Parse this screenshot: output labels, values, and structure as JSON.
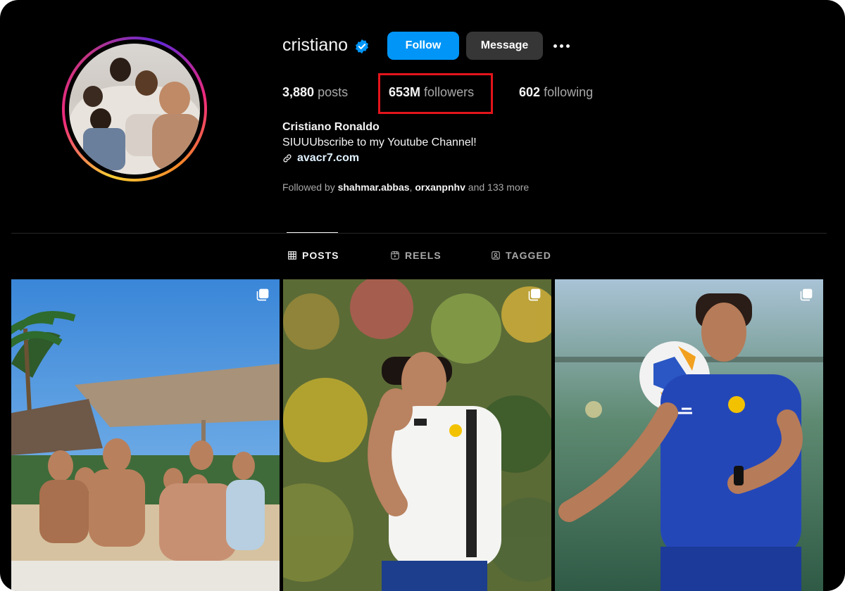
{
  "profile": {
    "username": "cristiano",
    "follow_label": "Follow",
    "message_label": "Message",
    "posts_count": "3,880",
    "posts_label": "posts",
    "followers_count": "653M",
    "followers_label": "followers",
    "following_count": "602",
    "following_label": "following",
    "full_name": "Cristiano Ronaldo",
    "bio": "SIUUUbscribe to my Youtube Channel!",
    "link": "avacr7.com",
    "followed_by_prefix": "Followed by",
    "followed_by_user1": "shahmar.abbas",
    "followed_by_sep": ",",
    "followed_by_user2": "orxanpnhv",
    "followed_by_suffix": "and 133 more"
  },
  "tabs": [
    {
      "label": "POSTS",
      "icon": "grid-icon",
      "active": true
    },
    {
      "label": "REELS",
      "icon": "reels-icon",
      "active": false
    },
    {
      "label": "TAGGED",
      "icon": "tagged-icon",
      "active": false
    }
  ],
  "posts": [
    {
      "icon": "multiple-photos-icon"
    },
    {
      "icon": "multiple-photos-icon"
    },
    {
      "icon": "multiple-photos-icon"
    }
  ],
  "colors": {
    "background": "#000000",
    "primary_button": "#0095f6",
    "secondary_button": "#363636",
    "highlight_box": "#e3141b",
    "verified": "#0095f6"
  }
}
